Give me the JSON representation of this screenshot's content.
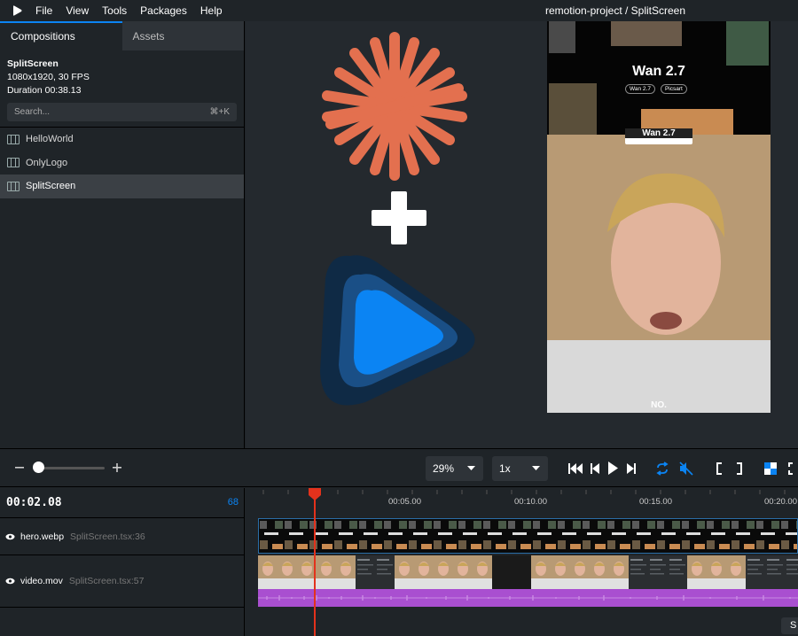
{
  "menubar": {
    "items": [
      "File",
      "View",
      "Tools",
      "Packages",
      "Help"
    ],
    "title": "remotion-project / SplitScreen"
  },
  "sidebar": {
    "tabs": [
      "Compositions",
      "Assets"
    ],
    "composition": {
      "name": "SplitScreen",
      "format": "1080x1920, 30 FPS",
      "duration": "Duration 00:38.13"
    },
    "search": {
      "placeholder": "Search...",
      "shortcut": "⌘+K"
    },
    "items": [
      "HelloWorld",
      "OnlyLogo",
      "SplitScreen"
    ]
  },
  "preview": {
    "hero_title": "Wan 2.7",
    "hero_badge_left": "Wan 2.7",
    "hero_badge_right": "Picsart",
    "banner": "Wan 2.7",
    "caption": "NO."
  },
  "controls": {
    "zoom_value": "29%",
    "speed_value": "1x"
  },
  "timeline": {
    "current_time": "00:02.08",
    "frame": "68",
    "ticks": [
      "00:05.00",
      "00:10.00",
      "00:15.00",
      "00:20.00"
    ],
    "tracks": [
      {
        "file": "hero.webp",
        "source": "SplitScreen.tsx:36"
      },
      {
        "file": "video.mov",
        "source": "SplitScreen.tsx:57"
      }
    ],
    "bottom_button": "S"
  },
  "colors": {
    "accent": "#0b84f3",
    "playhead": "#e3321c",
    "audio": "#a94fd0",
    "starburst": "#e3704f"
  }
}
